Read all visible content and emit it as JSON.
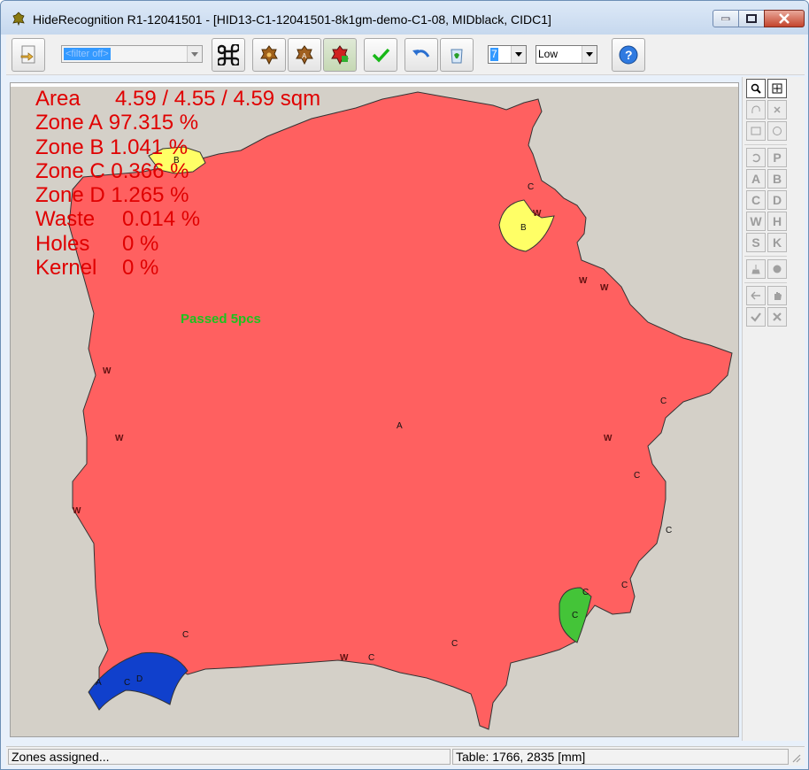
{
  "window": {
    "title": "HideRecognition R1-12041501 - [HID13-C1-12041501-8k1gm-demo-C1-08, MIDblack, CIDC1]"
  },
  "toolbar": {
    "filter_value": "<filter off>",
    "number_select": "7",
    "quality_select": "Low"
  },
  "stats": [
    {
      "label": "Area",
      "value": "4.59 / 4.55 / 4.59 sqm"
    },
    {
      "label": "Zone A",
      "value": "97.315 %"
    },
    {
      "label": "Zone B",
      "value": "1.041 %"
    },
    {
      "label": "Zone C",
      "value": "0.366 %"
    },
    {
      "label": "Zone D",
      "value": "1.265 %"
    },
    {
      "label": "Waste",
      "value": "0.014 %"
    },
    {
      "label": "Holes",
      "value": "0 %"
    },
    {
      "label": "Kernel",
      "value": "0 %"
    }
  ],
  "canvas": {
    "passed_text": "Passed 5pcs",
    "zone_marks": {
      "A": "A",
      "B": "B",
      "C": "C",
      "D": "D",
      "W": "W"
    }
  },
  "side_tools": {
    "letters": [
      "P",
      "A",
      "B",
      "C",
      "D",
      "W",
      "H",
      "S",
      "K"
    ]
  },
  "status": {
    "message": "Zones assigned...",
    "table": "Table: 1766, 2835 [mm]"
  },
  "colors": {
    "zone_a": "#ff6060",
    "zone_b": "#ffff66",
    "zone_c": "#44c438",
    "zone_d": "#1040cc",
    "stats_text": "#e00000",
    "passed_text": "#1ec21e"
  }
}
